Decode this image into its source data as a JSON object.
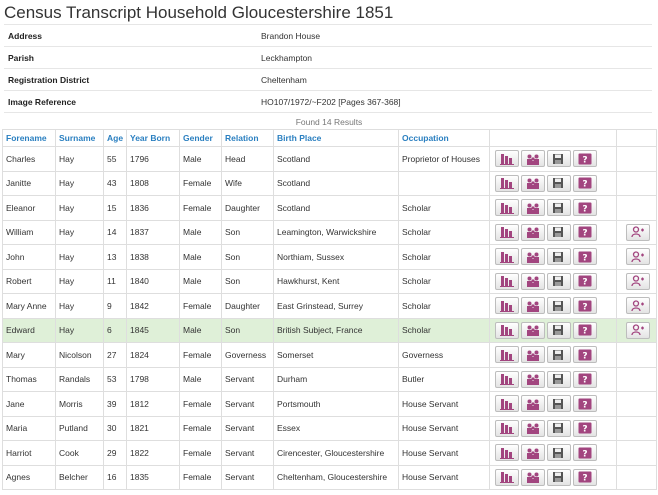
{
  "title": "Census Transcript Household Gloucestershire 1851",
  "meta": [
    {
      "key": "Address",
      "value": "Brandon House"
    },
    {
      "key": "Parish",
      "value": "Leckhampton"
    },
    {
      "key": "Registration District",
      "value": "Cheltenham"
    },
    {
      "key": "Image Reference",
      "value": "HO107/1972/~F202 [Pages 367-368]"
    }
  ],
  "found_text": "Found 14 Results",
  "columns": [
    "Forename",
    "Surname",
    "Age",
    "Year Born",
    "Gender",
    "Relation",
    "Birth Place",
    "Occupation"
  ],
  "rows": [
    {
      "forename": "Charles",
      "surname": "Hay",
      "age": "55",
      "born": "1796",
      "gender": "Male",
      "relation": "Head",
      "birthplace": "Scotland",
      "occupation": "Proprietor of Houses",
      "extra": false,
      "highlight": false
    },
    {
      "forename": "Janitte",
      "surname": "Hay",
      "age": "43",
      "born": "1808",
      "gender": "Female",
      "relation": "Wife",
      "birthplace": "Scotland",
      "occupation": "",
      "extra": false,
      "highlight": false
    },
    {
      "forename": "Eleanor",
      "surname": "Hay",
      "age": "15",
      "born": "1836",
      "gender": "Female",
      "relation": "Daughter",
      "birthplace": "Scotland",
      "occupation": "Scholar",
      "extra": false,
      "highlight": false
    },
    {
      "forename": "William",
      "surname": "Hay",
      "age": "14",
      "born": "1837",
      "gender": "Male",
      "relation": "Son",
      "birthplace": "Leamington, Warwickshire",
      "occupation": "Scholar",
      "extra": true,
      "highlight": false
    },
    {
      "forename": "John",
      "surname": "Hay",
      "age": "13",
      "born": "1838",
      "gender": "Male",
      "relation": "Son",
      "birthplace": "Northiam, Sussex",
      "occupation": "Scholar",
      "extra": true,
      "highlight": false
    },
    {
      "forename": "Robert",
      "surname": "Hay",
      "age": "11",
      "born": "1840",
      "gender": "Male",
      "relation": "Son",
      "birthplace": "Hawkhurst, Kent",
      "occupation": "Scholar",
      "extra": true,
      "highlight": false
    },
    {
      "forename": "Mary Anne",
      "surname": "Hay",
      "age": "9",
      "born": "1842",
      "gender": "Female",
      "relation": "Daughter",
      "birthplace": "East Grinstead, Surrey",
      "occupation": "Scholar",
      "extra": true,
      "highlight": false
    },
    {
      "forename": "Edward",
      "surname": "Hay",
      "age": "6",
      "born": "1845",
      "gender": "Male",
      "relation": "Son",
      "birthplace": "British Subject, France",
      "occupation": "Scholar",
      "extra": true,
      "highlight": true
    },
    {
      "forename": "Mary",
      "surname": "Nicolson",
      "age": "27",
      "born": "1824",
      "gender": "Female",
      "relation": "Governess",
      "birthplace": "Somerset",
      "occupation": "Governess",
      "extra": false,
      "highlight": false
    },
    {
      "forename": "Thomas",
      "surname": "Randals",
      "age": "53",
      "born": "1798",
      "gender": "Male",
      "relation": "Servant",
      "birthplace": "Durham",
      "occupation": "Butler",
      "extra": false,
      "highlight": false
    },
    {
      "forename": "Jane",
      "surname": "Morris",
      "age": "39",
      "born": "1812",
      "gender": "Female",
      "relation": "Servant",
      "birthplace": "Portsmouth",
      "occupation": "House Servant",
      "extra": false,
      "highlight": false
    },
    {
      "forename": "Maria",
      "surname": "Putland",
      "age": "30",
      "born": "1821",
      "gender": "Female",
      "relation": "Servant",
      "birthplace": "Essex",
      "occupation": "House Servant",
      "extra": false,
      "highlight": false
    },
    {
      "forename": "Harriot",
      "surname": "Cook",
      "age": "29",
      "born": "1822",
      "gender": "Female",
      "relation": "Servant",
      "birthplace": "Cirencester, Gloucestershire",
      "occupation": "House Servant",
      "extra": false,
      "highlight": false
    },
    {
      "forename": "Agnes",
      "surname": "Belcher",
      "age": "16",
      "born": "1835",
      "gender": "Female",
      "relation": "Servant",
      "birthplace": "Cheltenham, Gloucestershire",
      "occupation": "House Servant",
      "extra": false,
      "highlight": false
    }
  ],
  "icons": {
    "action_buttons": [
      "census-ledger-icon",
      "family-group-icon",
      "save-icon",
      "help-question-icon"
    ],
    "extra_button": "person-link-icon"
  },
  "colors": {
    "link": "#2a7fc0",
    "highlight_row": "#dff0d8",
    "icon": "#a2457f"
  }
}
